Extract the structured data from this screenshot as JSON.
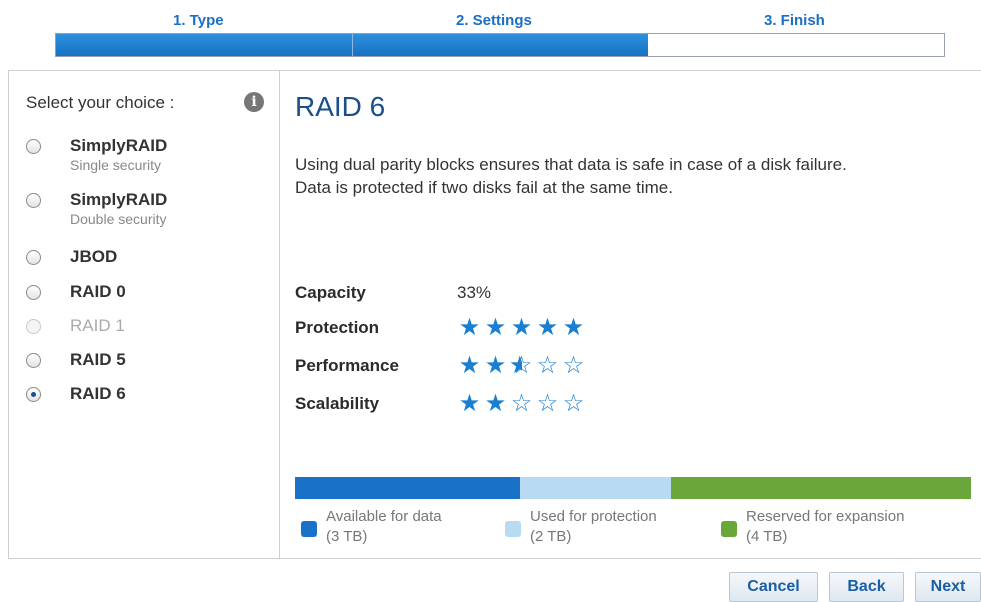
{
  "wizard": {
    "steps": [
      {
        "label": "1. Type"
      },
      {
        "label": "2. Settings"
      },
      {
        "label": "3. Finish"
      }
    ],
    "progress_fraction": 0.667
  },
  "sidebar": {
    "select_label": "Select your choice :",
    "info_icon": "info-icon",
    "options": [
      {
        "name": "SimplyRAID",
        "sub": "Single security",
        "state": "unchecked"
      },
      {
        "name": "SimplyRAID",
        "sub": "Double security",
        "state": "unchecked"
      },
      {
        "name": "JBOD",
        "sub": "",
        "state": "unchecked"
      },
      {
        "name": "RAID 0",
        "sub": "",
        "state": "unchecked"
      },
      {
        "name": "RAID 1",
        "sub": "",
        "state": "disabled"
      },
      {
        "name": "RAID 5",
        "sub": "",
        "state": "unchecked"
      },
      {
        "name": "RAID 6",
        "sub": "",
        "state": "checked"
      }
    ]
  },
  "main": {
    "title": "RAID 6",
    "description_1": "Using dual parity blocks ensures that data is safe in case of a disk failure.",
    "description_2": "Data is protected if two disks fail at the same time.",
    "metrics": {
      "capacity_label": "Capacity",
      "capacity_value": "33%",
      "protection_label": "Protection",
      "protection_stars": 5,
      "performance_label": "Performance",
      "performance_stars": 2.5,
      "scalability_label": "Scalability",
      "scalability_stars": 2
    },
    "storage": {
      "available_label": "Available for data",
      "available_size": "(3 TB)",
      "available_tb": 3,
      "protection_label": "Used for protection",
      "protection_size": "(2 TB)",
      "protection_tb": 2,
      "reserved_label": "Reserved for expansion",
      "reserved_size": "(4 TB)",
      "reserved_tb": 4
    }
  },
  "colors": {
    "accent": "#1a7fd0",
    "available": "#1a72c8",
    "protection": "#b9dbf2",
    "reserved": "#6aa63a"
  },
  "buttons": {
    "cancel": "Cancel",
    "back": "Back",
    "next": "Next"
  }
}
